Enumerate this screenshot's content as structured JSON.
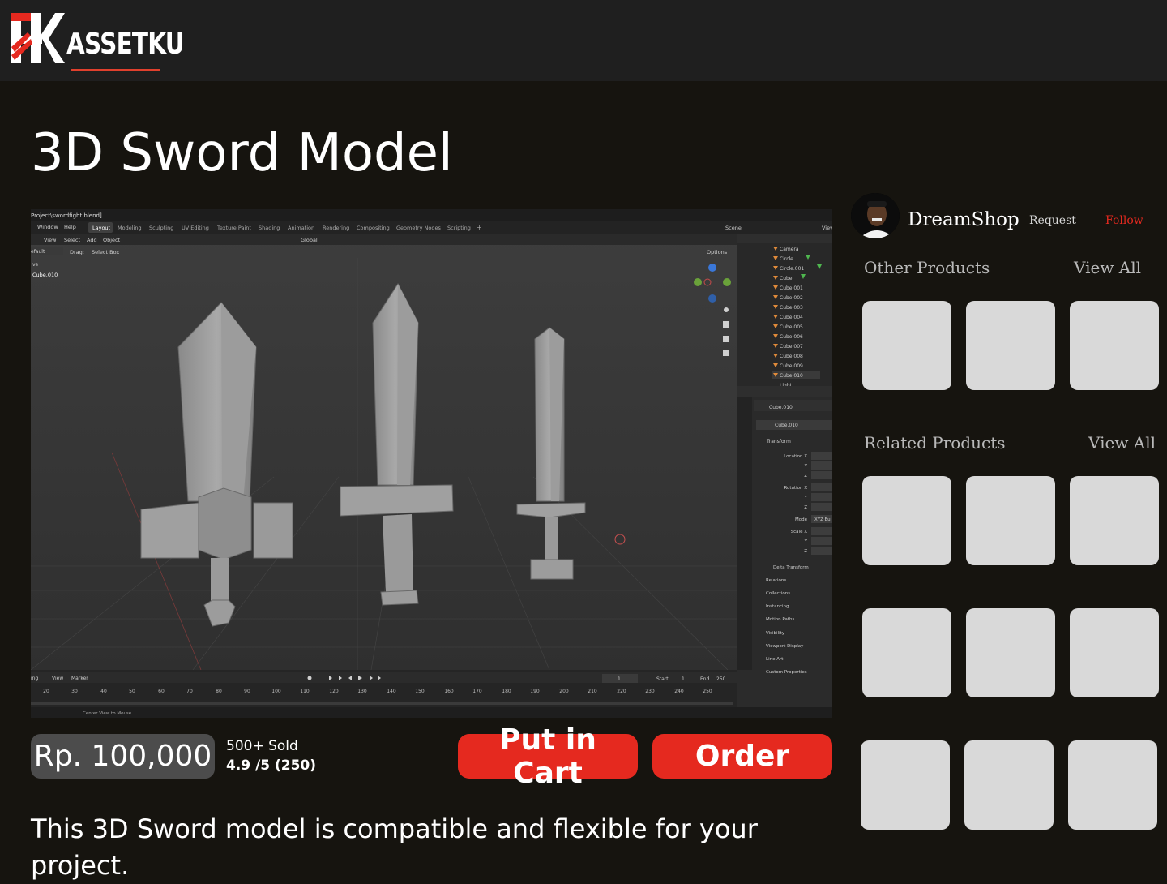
{
  "brand": {
    "name": "ASSETKU",
    "accent_color": "#e5291f"
  },
  "product": {
    "title": "3D Sword Model",
    "price": "Rp. 100,000",
    "sold": "500+ Sold",
    "rating": "4.9 /5 (250)",
    "description": "This 3D Sword model is compatible and flexible for your project."
  },
  "actions": {
    "cart_label": "Put in Cart",
    "order_label": "Order"
  },
  "seller": {
    "name": "DreamShop",
    "request_label": "Request",
    "follow_label": "Follow"
  },
  "sections": {
    "other_title": "Other Products",
    "other_view_all": "View All",
    "related_title": "Related Products",
    "related_view_all": "View All"
  },
  "blender": {
    "file_path": "Project\\swordfight.blend]",
    "menu": [
      "Window",
      "Help"
    ],
    "workspaces": [
      "Layout",
      "Modeling",
      "Sculpting",
      "UV Editing",
      "Texture Paint",
      "Shading",
      "Animation",
      "Rendering",
      "Compositing",
      "Geometry Nodes",
      "Scripting",
      "+"
    ],
    "header_menus": [
      "View",
      "Select",
      "Add",
      "Object"
    ],
    "mode": "efault",
    "drag_label": "Drag:",
    "drag_value": "Select Box",
    "transform_orientation": "Global",
    "options_label": "Options",
    "active_object": "Cube.010",
    "scene_label": "Scene",
    "view_layer_label": "View",
    "outliner_items": [
      "Camera",
      "Circle",
      "Circle.001",
      "Cube",
      "Cube.001",
      "Cube.002",
      "Cube.003",
      "Cube.004",
      "Cube.005",
      "Cube.006",
      "Cube.007",
      "Cube.008",
      "Cube.009",
      "Cube.010",
      "Light"
    ],
    "properties": {
      "object_name": "Cube.010",
      "data_name": "Cube.010",
      "transform_label": "Transform",
      "location_label": "Location X",
      "rotation_label": "Rotation X",
      "mode_label": "Mode",
      "mode_value": "XYZ Eu",
      "scale_label": "Scale X",
      "y_label": "Y",
      "z_label": "Z",
      "panels": [
        "Delta Transform",
        "Relations",
        "Collections",
        "Instancing",
        "Motion Paths",
        "Visibility",
        "Viewport Display",
        "Line Art",
        "Custom Properties"
      ]
    },
    "timeline": {
      "menus": [
        "ing",
        "View",
        "Marker"
      ],
      "current_frame": "1",
      "start_label": "Start",
      "start_value": "1",
      "end_label": "End",
      "end_value": "250",
      "ticks": [
        "20",
        "30",
        "40",
        "50",
        "60",
        "70",
        "80",
        "90",
        "100",
        "110",
        "120",
        "130",
        "140",
        "150",
        "160",
        "170",
        "180",
        "190",
        "200",
        "210",
        "220",
        "230",
        "240",
        "250"
      ]
    },
    "status_hint": "Center View to Mouse"
  }
}
